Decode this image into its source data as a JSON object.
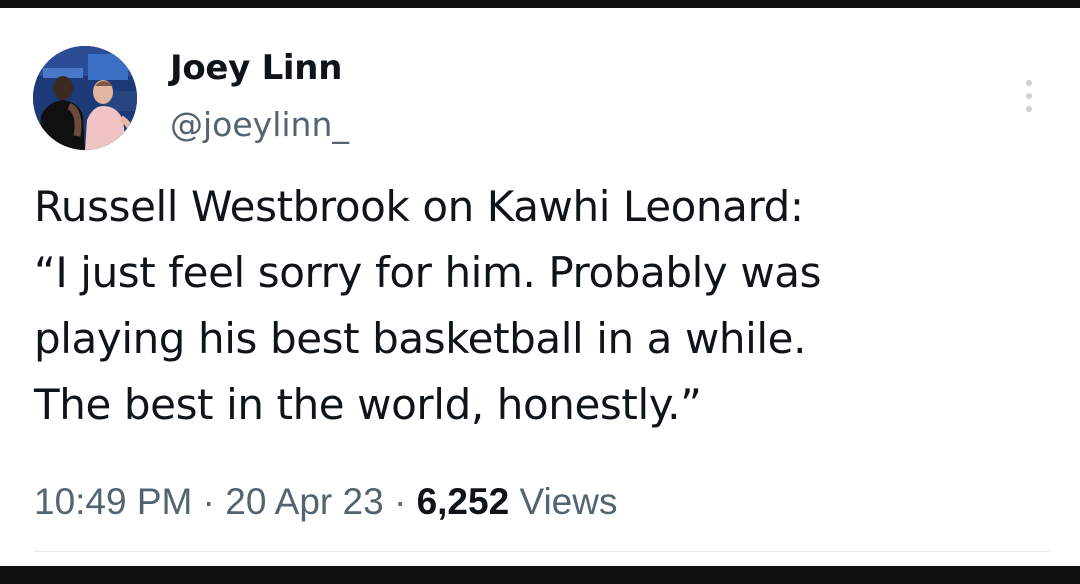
{
  "tweet": {
    "author": {
      "display_name": "Joey Linn",
      "handle": "@joeylinn_",
      "avatar": "profile-photo"
    },
    "text": "Russell Westbrook on Kawhi Leonard:\n“I just feel sorry for him. Probably was\nplaying his best basketball in a while.\nThe best in the world, honestly.”",
    "time": "10:49 PM",
    "date": "20 Apr 23",
    "separator": "·",
    "views_count": "6,252",
    "views_label": "Views",
    "more_icon": "more-vertical-icon"
  },
  "colors": {
    "text_primary": "#0f1419",
    "text_secondary": "#536471",
    "background": "#ffffff"
  }
}
